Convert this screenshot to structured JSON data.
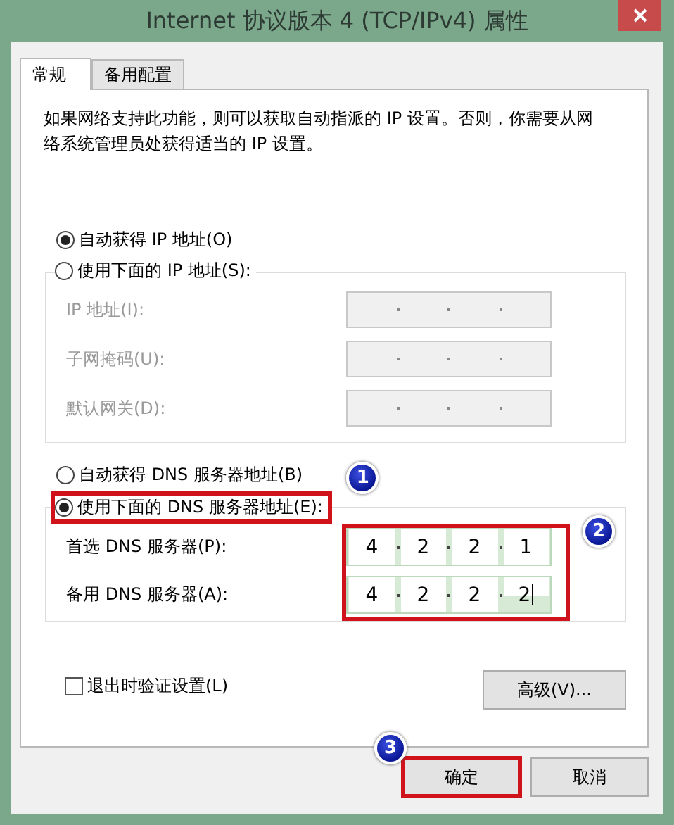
{
  "window": {
    "title": "Internet 协议版本 4 (TCP/IPv4) 属性"
  },
  "tabs": [
    {
      "label": "常规",
      "selected": true
    },
    {
      "label": "备用配置",
      "selected": false
    }
  ],
  "description": "如果网络支持此功能，则可以获取自动指派的 IP 设置。否则，你需要从网络系统管理员处获得适当的 IP 设置。",
  "ip_options": [
    {
      "label": "自动获得 IP 地址(O)",
      "selected": true
    },
    {
      "label": "使用下面的 IP 地址(S):",
      "selected": false
    }
  ],
  "ip_fields": [
    {
      "label": "IP 地址(I):",
      "disabled": true
    },
    {
      "label": "子网掩码(U):",
      "disabled": true
    },
    {
      "label": "默认网关(D):",
      "disabled": true
    }
  ],
  "dns_options": [
    {
      "label": "自动获得 DNS 服务器地址(B)",
      "selected": false
    },
    {
      "label": "使用下面的 DNS 服务器地址(E):",
      "selected": true,
      "annotation": "1"
    }
  ],
  "dns_fields": {
    "annotation": "2",
    "items": [
      {
        "label": "首选 DNS 服务器(P):",
        "disabled": false,
        "octets": [
          "4",
          "2",
          "2",
          "1"
        ],
        "focused": false
      },
      {
        "label": "备用 DNS 服务器(A):",
        "disabled": false,
        "octets": [
          "4",
          "2",
          "2",
          "2"
        ],
        "focused": true
      }
    ]
  },
  "validate_checkbox": {
    "label": "退出时验证设置(L)",
    "checked": false
  },
  "advanced_button": "高级(V)...",
  "buttons": [
    {
      "label": "确定",
      "annotation": "3"
    },
    {
      "label": "取消"
    }
  ]
}
